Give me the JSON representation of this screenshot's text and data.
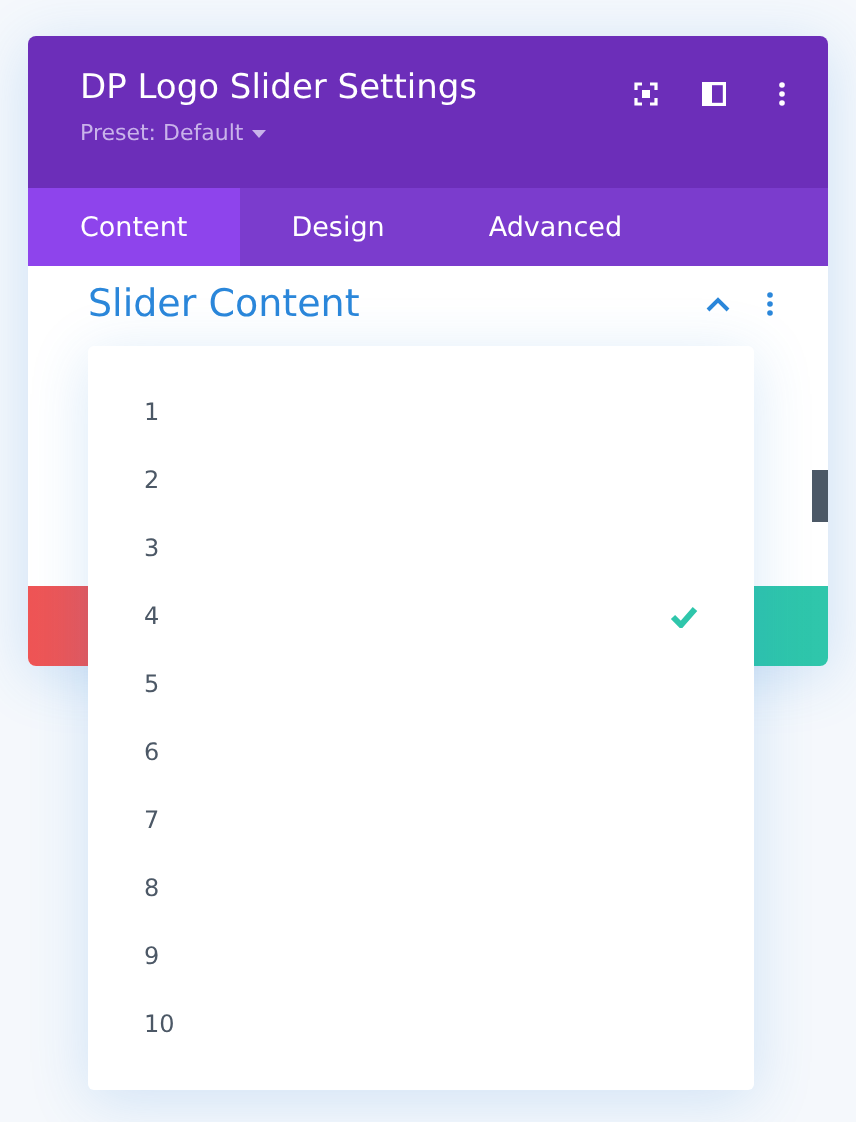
{
  "window": {
    "title": "DP Logo Slider Settings",
    "preset": "Preset: Default"
  },
  "tabs": [
    {
      "label": "Content",
      "selected": true
    },
    {
      "label": "Design",
      "selected": false
    },
    {
      "label": "Advanced",
      "selected": false
    }
  ],
  "section": {
    "title": "Slider Content",
    "expanded": true
  },
  "dropdown": {
    "options": [
      {
        "label": "1",
        "selected": false
      },
      {
        "label": "2",
        "selected": false
      },
      {
        "label": "3",
        "selected": false
      },
      {
        "label": "4",
        "selected": true
      },
      {
        "label": "5",
        "selected": false
      },
      {
        "label": "6",
        "selected": false
      },
      {
        "label": "7",
        "selected": false
      },
      {
        "label": "8",
        "selected": false
      },
      {
        "label": "9",
        "selected": false
      },
      {
        "label": "10",
        "selected": false
      }
    ]
  }
}
